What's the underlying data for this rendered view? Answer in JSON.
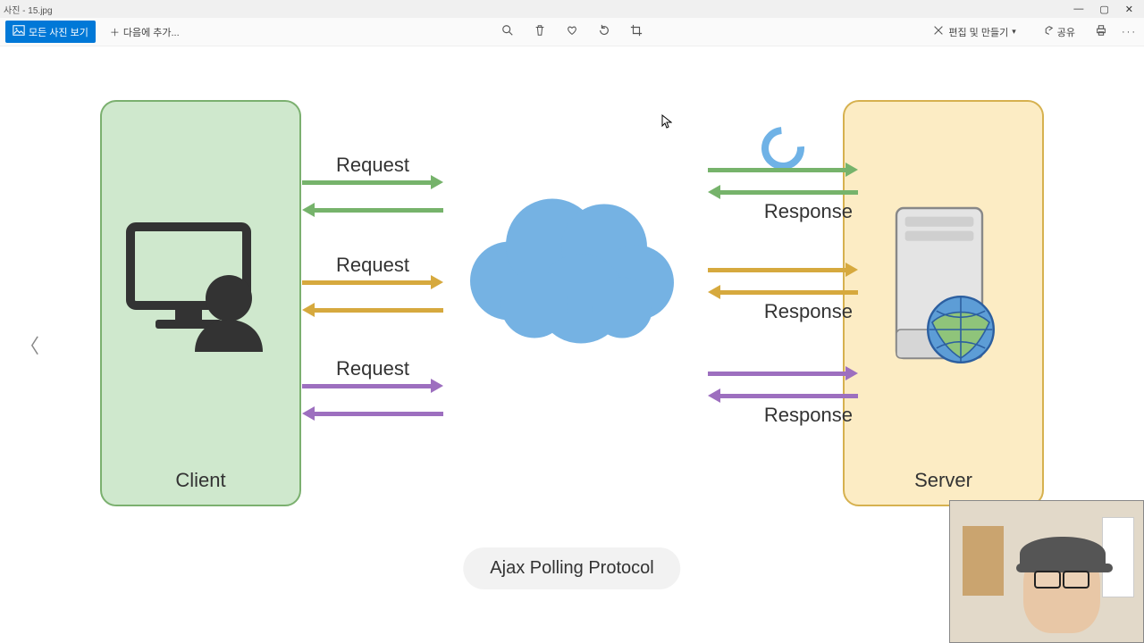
{
  "window": {
    "title": "사진 - 15.jpg"
  },
  "toolbar": {
    "view_all": "모든 사진 보기",
    "add_next": "다음에 추가...",
    "edit_create": "편집 및 만들기",
    "share": "공유"
  },
  "diagram": {
    "client_label": "Client",
    "server_label": "Server",
    "caption": "Ajax Polling Protocol",
    "rows": [
      {
        "request": "Request",
        "response": "Response",
        "color": "#76b36b"
      },
      {
        "request": "Request",
        "response": "Response",
        "color": "#d6a93e"
      },
      {
        "request": "Request",
        "response": "Response",
        "color": "#9d6fbf"
      }
    ]
  }
}
